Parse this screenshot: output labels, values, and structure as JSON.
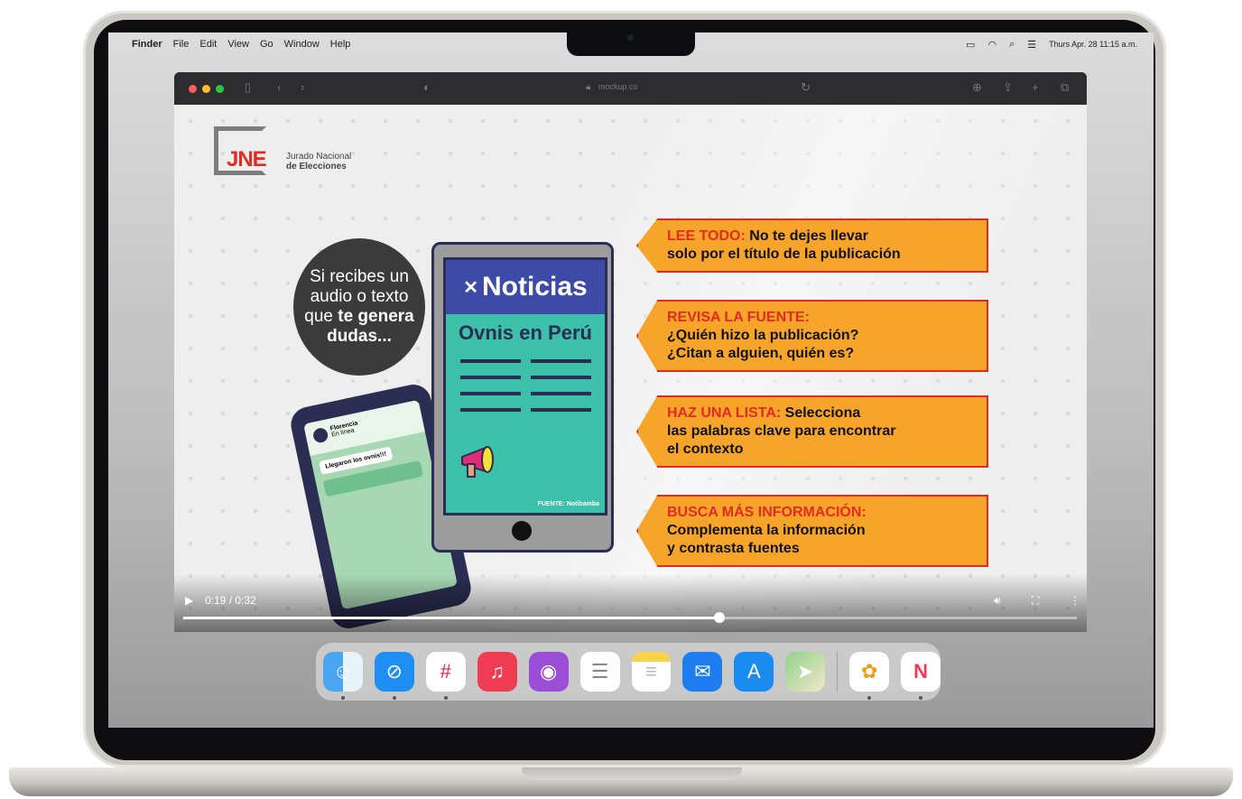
{
  "menubar": {
    "apple": "",
    "items": [
      "Finder",
      "File",
      "Edit",
      "View",
      "Go",
      "Window",
      "Help"
    ],
    "datetime": "Thurs Apr. 28 11:15 a.m."
  },
  "browser": {
    "url": "mockup.co"
  },
  "video": {
    "logo": {
      "letters": "JNE",
      "line1": "Jurado Nacional",
      "line2": "de Elecciones"
    },
    "bubble": {
      "line1": "Si recibes un",
      "line2": "audio o texto",
      "line3_plain": "que ",
      "line3_bold": "te genera",
      "line4": "dudas..."
    },
    "phone": {
      "contact": "Florencia",
      "status": "En línea",
      "message": "Llegaron los ovnis!!!"
    },
    "tablet": {
      "header": "Noticias",
      "headline": "Ovnis en Perú",
      "source": "FUENTE: Notibamba"
    },
    "tips": [
      {
        "key": "LEE TODO:",
        "text1": " No te dejes llevar",
        "text2": "solo por el título de la publicación",
        "text3": ""
      },
      {
        "key": "REVISA LA FUENTE:",
        "text1": "",
        "text2": "¿Quién hizo la publicación?",
        "text3": "¿Citan a alguien, quién es?"
      },
      {
        "key": "HAZ UNA LISTA:",
        "text1": " Selecciona",
        "text2": "las palabras clave para encontrar",
        "text3": "el contexto"
      },
      {
        "key": "BUSCA MÁS INFORMACIÓN:",
        "text1": "",
        "text2": "Complementa la información",
        "text3": "y contrasta fuentes"
      }
    ],
    "controls": {
      "time": "0:19 / 0:32",
      "progress": 0.6
    }
  },
  "colors": {
    "accent_red": "#e42b23",
    "tip_orange": "#f6a42a",
    "navy": "#2b2d52"
  }
}
